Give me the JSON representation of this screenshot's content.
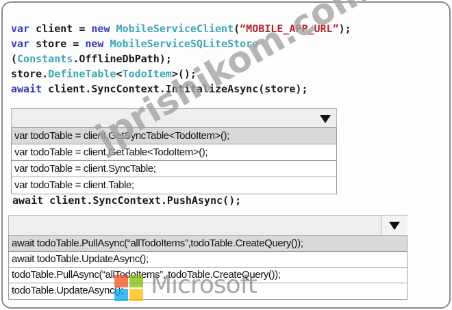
{
  "code_block": {
    "line1": {
      "kw1": "var",
      "t1": " client = ",
      "kw2": "new",
      "t2": " ",
      "type": "MobileServiceClient",
      "t3": "(",
      "str": "“MOBILE_APP_URL”",
      "t4": ");"
    },
    "line2": {
      "kw1": "var",
      "t1": " store = ",
      "kw2": "new",
      "t2": " ",
      "type": "MobileServiceSQLiteStore"
    },
    "line3": {
      "t1": "(",
      "type": "Constants",
      "t2": ".OfflineDbPath);"
    },
    "line4": {
      "t1": "store.",
      "type1": "DefineTable",
      "t2": "<",
      "type2": "TodoItem",
      "t3": ">();"
    },
    "line5": {
      "kw1": "await",
      "t1": " client.SyncContext.IntitalizeAsync(store);"
    }
  },
  "middle_line": "await client.SyncContext.PushAsync();",
  "dropdown1": {
    "selected": "",
    "options": [
      "var todoTable = client.GetSyncTable<TodoItem>();",
      "var todoTable = client.GetTable<TodoItem>();",
      "var todoTable = client.SyncTable;",
      "var todoTable = client.Table;"
    ]
  },
  "dropdown2": {
    "selected": "",
    "options": [
      "await todoTable.PullAsync(“allTodoItems”,todoTable.CreateQuery());",
      "await todoTable.UpdateAsync();",
      "todoTable.PullAsync(“allTodoItems”, todoTable.CreateQuery());",
      "todoTable.UpdateAsync();"
    ]
  },
  "watermark": "jprishikom.com",
  "brand": {
    "text": "Microsoft",
    "colors": [
      "#f25022",
      "#7fba00",
      "#00a4ef",
      "#ffb900"
    ]
  },
  "icons": {
    "dropdown_arrow": "chevron-down-icon"
  }
}
